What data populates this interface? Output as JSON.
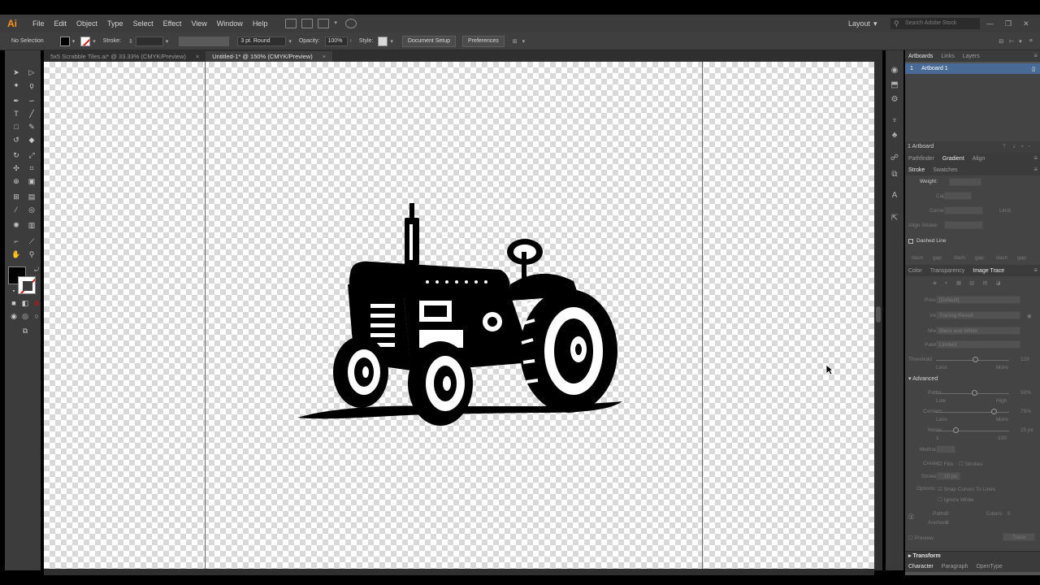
{
  "app": {
    "logo": "Ai",
    "accent": "#f7931e"
  },
  "menus": [
    "File",
    "Edit",
    "Object",
    "Type",
    "Select",
    "Effect",
    "View",
    "Window",
    "Help"
  ],
  "workspace": {
    "label": "Layout"
  },
  "stock_search": {
    "placeholder": "Search Adobe Stock"
  },
  "control_bar": {
    "selection": "No Selection",
    "stroke_label": "Stroke:",
    "brush_value": "3 pt. Round",
    "opacity_label": "Opacity:",
    "opacity_value": "100%",
    "style_label": "Style:",
    "document_setup": "Document Setup",
    "preferences": "Preferences"
  },
  "doc_tabs": [
    {
      "title": "5x5 Scrabble Tiles.ai* @ 33.33% (CMYK/Preview)",
      "close": "×"
    },
    {
      "title": "Untitled-1* @ 150% (CMYK/Preview)",
      "close": "×"
    }
  ],
  "panels": {
    "top_tabs": [
      "Artboards",
      "Links",
      "Layers"
    ],
    "artboard": {
      "number": "1",
      "name": "Artboard 1"
    },
    "artboard_count": "1 Artboard",
    "mid_tabs": [
      "Pathfinder",
      "Gradient",
      "Align"
    ],
    "stroke_tabs": [
      "Stroke",
      "Swatches"
    ],
    "stroke": {
      "weight_label": "Weight:",
      "cap_label": "Cap:",
      "corner_label": "Corner:",
      "limit_label": "Limit:",
      "align_label": "Align Stroke:",
      "dashed_label": "Dashed Line",
      "dash_labels": [
        "dash",
        "gap",
        "dash",
        "gap",
        "dash",
        "gap"
      ]
    },
    "trace_tabs": [
      "Color",
      "Transparency",
      "Image Trace"
    ],
    "image_trace": {
      "preset_label": "Preset:",
      "preset_value": "[Default]",
      "view_label": "View:",
      "view_value": "Tracing Result",
      "mode_label": "Mode:",
      "mode_value": "Black and White",
      "palette_label": "Palette:",
      "palette_value": "Limited",
      "threshold_label": "Threshold:",
      "threshold_value": "128",
      "less": "Less",
      "more": "More",
      "advanced": "Advanced",
      "paths_label": "Paths:",
      "paths_value": "50%",
      "low": "Low",
      "high": "High",
      "corners_label": "Corners:",
      "corners_value": "75%",
      "noise_label": "Noise:",
      "noise_value": "25 px",
      "noise_min": "1",
      "noise_max": "100",
      "method_label": "Method:",
      "create_label": "Create:",
      "fills": "Fills",
      "strokes": "Strokes",
      "stroke_label": "Stroke:",
      "stroke_value": "10 px",
      "options_label": "Options:",
      "snap_curves": "Snap Curves To Lines",
      "ignore_white": "Ignore White",
      "paths_count_label": "Paths:",
      "paths_count": "0",
      "colors_label": "Colors:",
      "colors_count": "0",
      "anchors_label": "Anchors:",
      "anchors_count": "0",
      "preview": "Preview",
      "trace": "Trace"
    },
    "bottom_sections": [
      "Transform"
    ],
    "bottom_tabs": [
      "Character",
      "Paragraph",
      "OpenType"
    ]
  },
  "colors": {
    "ui_dark": "#3c3c3c",
    "panel": "#535353",
    "artboard_highlight": "#4a6a96",
    "none_red": "#e01010"
  }
}
